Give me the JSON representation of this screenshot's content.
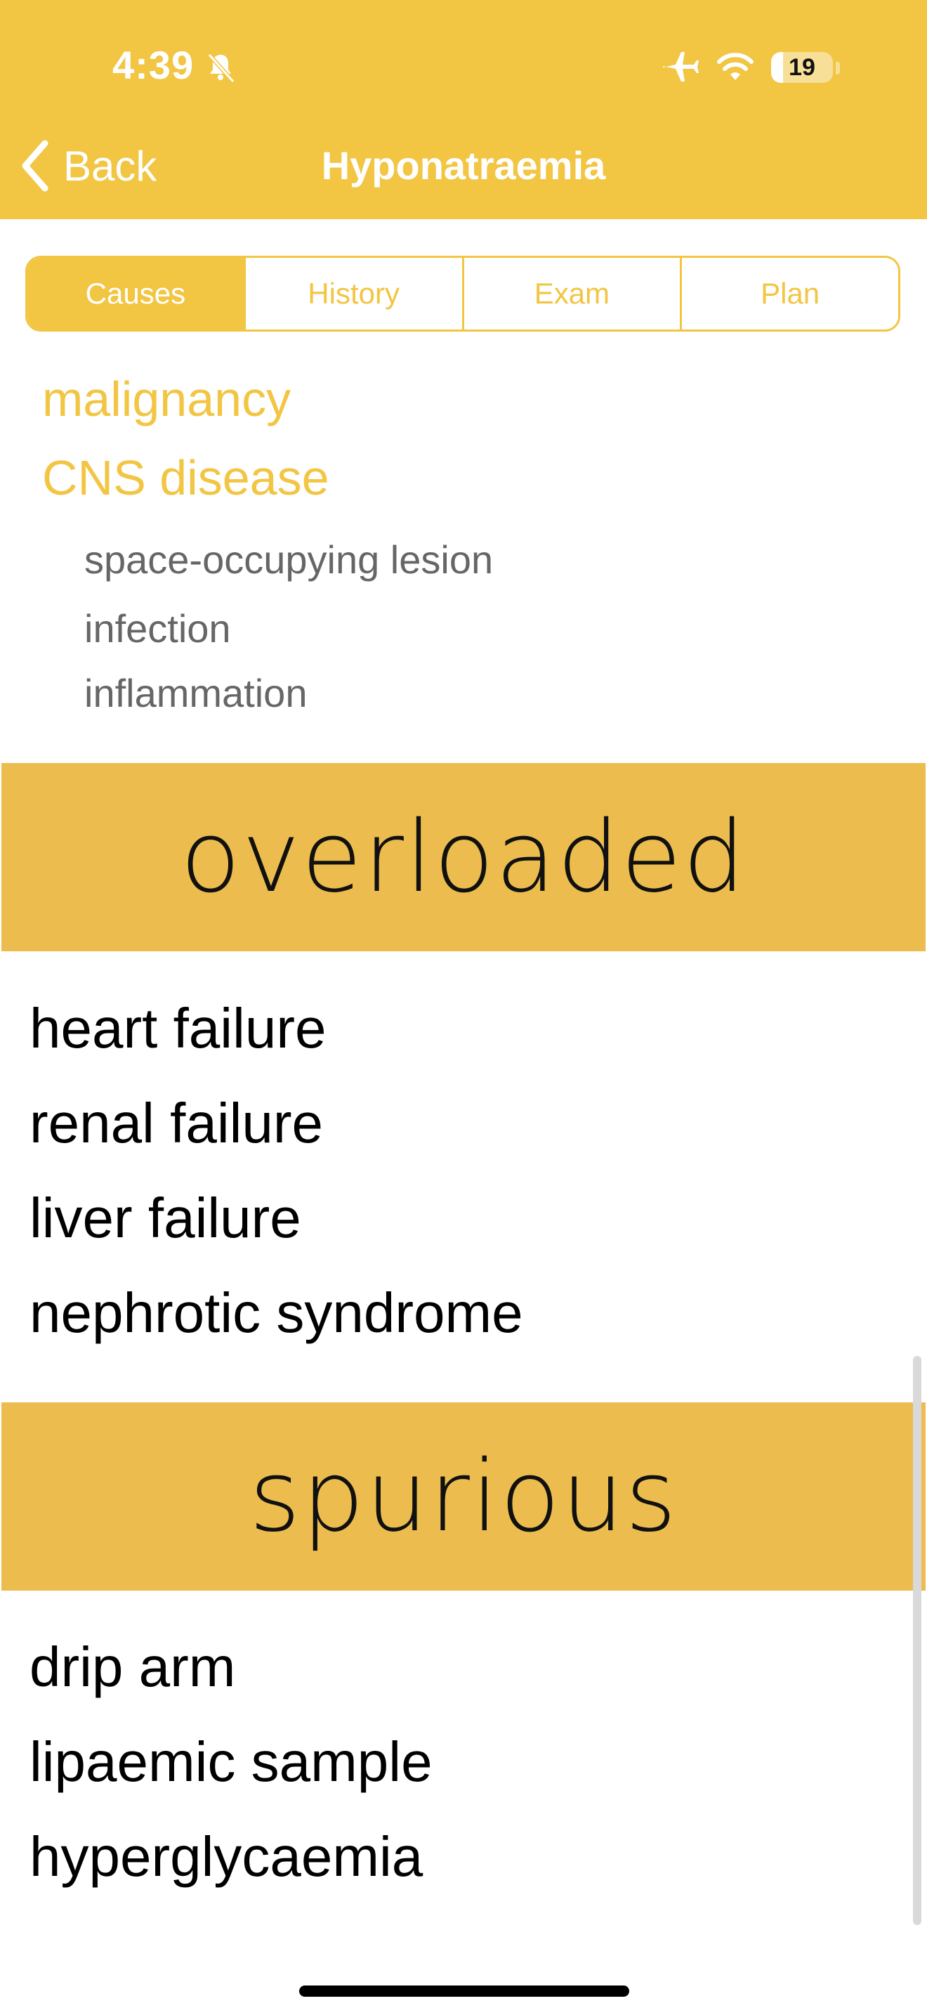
{
  "status_bar": {
    "time": "4:39",
    "battery": "19",
    "icons": [
      "bell-slash-icon",
      "airplane-icon",
      "wifi-icon",
      "battery-icon"
    ]
  },
  "nav": {
    "back_label": "Back",
    "title": "Hyponatraemia"
  },
  "tabs": [
    {
      "label": "Causes",
      "active": true
    },
    {
      "label": "History",
      "active": false
    },
    {
      "label": "Exam",
      "active": false
    },
    {
      "label": "Plan",
      "active": false
    }
  ],
  "causes": {
    "groups": [
      "malignancy",
      "CNS disease"
    ],
    "cns_subitems": [
      "space-occupying lesion",
      "infection",
      "inflammation"
    ]
  },
  "sections": [
    {
      "title": "overloaded",
      "items": [
        "heart failure",
        "renal failure",
        "liver failure",
        "nephrotic syndrome"
      ]
    },
    {
      "title": "spurious",
      "items": [
        "drip arm",
        "lipaemic sample",
        "hyperglycaemia"
      ]
    }
  ],
  "colors": {
    "header": "#F2C543",
    "band": "#ECBD4E",
    "accent_text": "#F2C543"
  }
}
